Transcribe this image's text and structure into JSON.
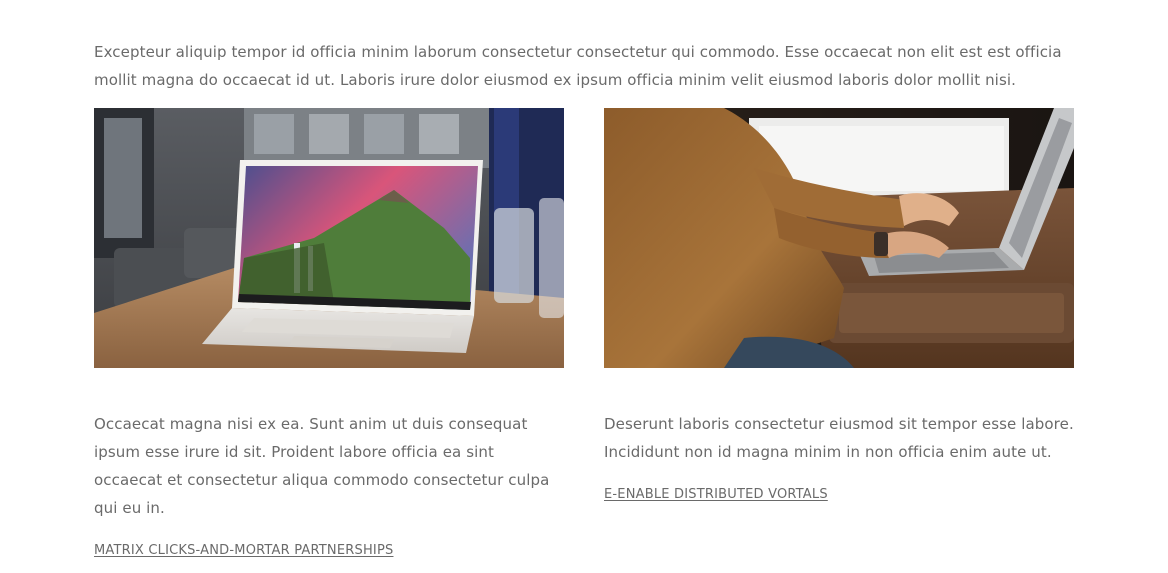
{
  "intro": {
    "text": "Excepteur aliquip tempor id officia minim laborum consectetur consectetur qui commodo. Esse occaecat non elit est est officia mollit magna do occaecat id ut. Laboris irure dolor eiusmod ex ipsum officia minim velit eiusmod laboris dolor mollit nisi."
  },
  "cards": [
    {
      "image": "laptop-on-table-photo",
      "text": "Occaecat magna nisi ex ea. Sunt anim ut duis consequat ipsum esse irure id sit. Proident labore officia ea sint occaecat et consectetur aliqua commodo consectetur culpa qui eu in.",
      "link": "MATRIX CLICKS-AND-MORTAR PARTNERSHIPS"
    },
    {
      "image": "typing-on-laptop-photo",
      "text": "Deserunt laboris consectetur eiusmod sit tempor esse labore. Incididunt non id magna minim in non officia enim aute ut.",
      "link": "E-ENABLE DISTRIBUTED VORTALS"
    }
  ],
  "colors": {
    "text": "#6a6a6a",
    "background": "#ffffff"
  }
}
